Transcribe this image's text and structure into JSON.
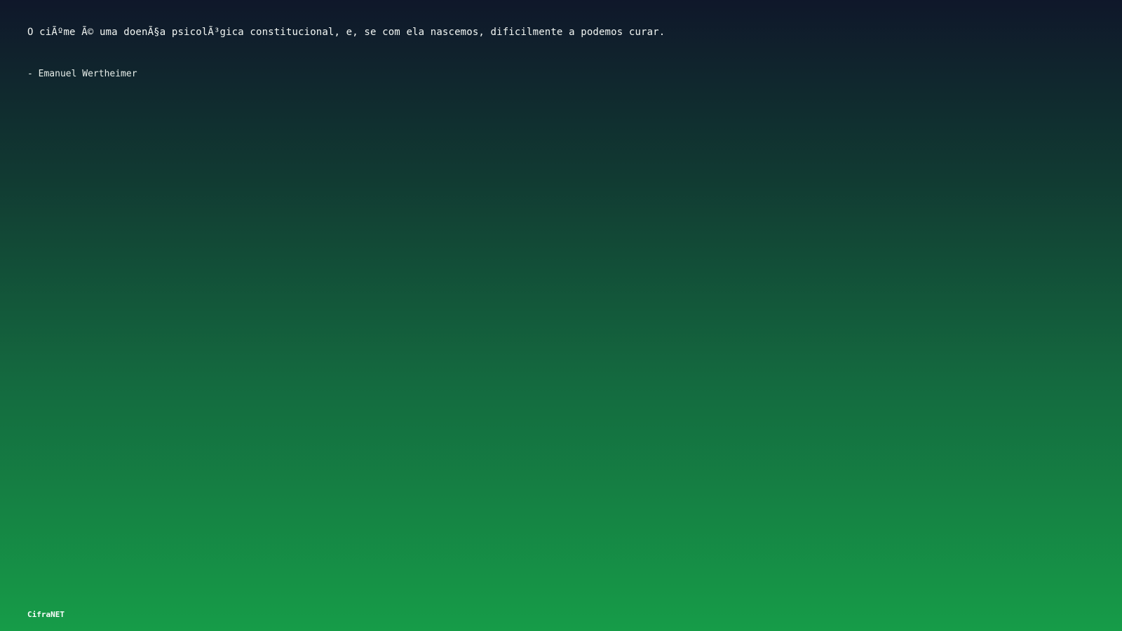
{
  "quote": {
    "text": "O ciÃºme Ã© uma doenÃ§a psicolÃ³gica constitucional, e, se com ela nascemos, dificilmente a podemos curar.",
    "author": "- Emanuel Wertheimer"
  },
  "footer": {
    "brand": "CifraNET"
  },
  "colors": {
    "gradient_top": "#0f172a",
    "gradient_bottom": "#169c48",
    "text": "#ffffff"
  }
}
